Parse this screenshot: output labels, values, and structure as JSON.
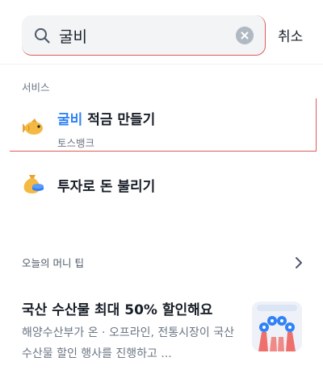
{
  "search": {
    "value": "굴비",
    "cancel_label": "취소"
  },
  "services": {
    "section_title": "서비스",
    "items": [
      {
        "title_highlight": "굴비",
        "title_rest": " 적금 만들기",
        "subtitle": "토스뱅크",
        "icon": "fish-icon"
      },
      {
        "title_highlight": "",
        "title_rest": "투자로 돈 불리기",
        "subtitle": "",
        "icon": "money-bag-icon"
      }
    ]
  },
  "tips": {
    "section_title": "오늘의 머니 팁",
    "card": {
      "title": "국산 수산물 최대 50% 할인해요",
      "description": "해양수산부가 온 · 오프라인, 전통시장이 국산 수산물 할인 행사를 진행하고 ...",
      "image": "seafood-promo-image"
    }
  },
  "colors": {
    "accent": "#3182f6",
    "text_primary": "#191f28",
    "text_secondary": "#6b7684",
    "search_bg": "#f2f4f6"
  }
}
